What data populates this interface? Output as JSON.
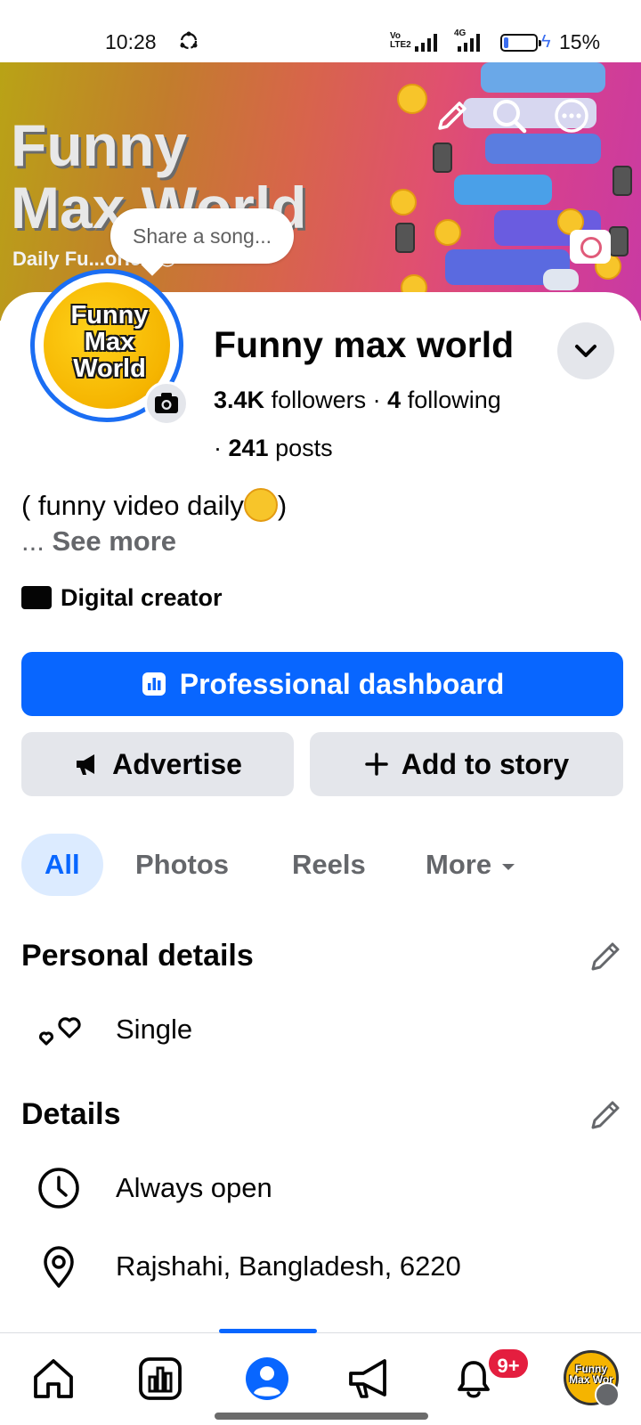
{
  "status_bar": {
    "time": "10:28",
    "volte_label": "Vo LTE2",
    "network": "4G",
    "battery_percent": "15%",
    "battery_level": 0.15
  },
  "cover": {
    "title_line1": "Funny",
    "title_line2": "Max World",
    "subtitle": "Daily Fu...ories 😎"
  },
  "share_song": "Share a song...",
  "avatar": {
    "text": "Funny Max World"
  },
  "profile": {
    "name": "Funny max world",
    "followers_count": "3.4K",
    "followers_label": "followers",
    "separator": "·",
    "following_count": "4",
    "following_label": "following",
    "posts_count": "241",
    "posts_label": "posts",
    "bio": "( funny video daily",
    "bio_close": ")",
    "ellipsis": "...",
    "see_more": "See more",
    "category": "Digital creator"
  },
  "buttons": {
    "dashboard": "Professional dashboard",
    "advertise": "Advertise",
    "add_to_story": "Add to story"
  },
  "tabs": [
    {
      "label": "All",
      "active": true
    },
    {
      "label": "Photos",
      "active": false
    },
    {
      "label": "Reels",
      "active": false
    },
    {
      "label": "More",
      "active": false
    }
  ],
  "personal_details": {
    "title": "Personal details",
    "items": [
      {
        "icon": "hearts-icon",
        "text": "Single"
      }
    ]
  },
  "details": {
    "title": "Details",
    "items": [
      {
        "icon": "clock-icon",
        "text": "Always open"
      },
      {
        "icon": "location-pin-icon",
        "text": "Rajshahi, Bangladesh, 6220"
      }
    ]
  },
  "bottom_nav": {
    "items": [
      "home-icon",
      "dashboard-icon",
      "profile-icon",
      "megaphone-icon",
      "bell-icon",
      "menu-avatar"
    ],
    "notification_badge": "9+",
    "avatar_text": "Funny Max Wor"
  },
  "colors": {
    "primary": "#0866ff",
    "secondary_bg": "#e4e6eb",
    "badge": "#e41e3f",
    "muted_text": "#65676b"
  }
}
